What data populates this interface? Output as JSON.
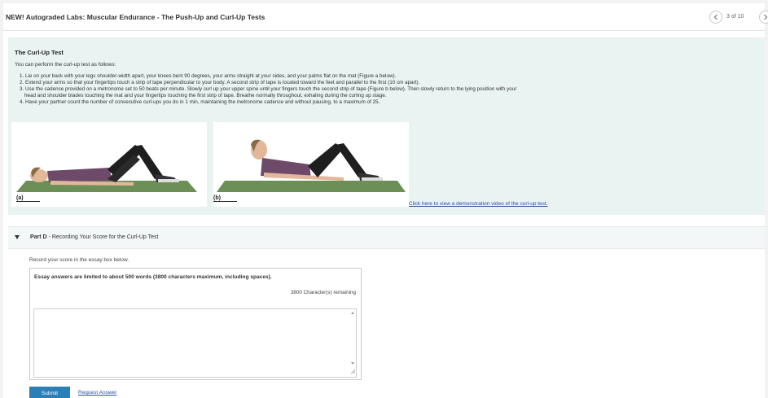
{
  "header": {
    "title": "NEW! Autograded Labs: Muscular Endurance - The Push-Up and Curl-Up Tests",
    "page_count": "3 of 10"
  },
  "panel": {
    "heading": "The Curl-Up Test",
    "intro": "You can perform the curl-up test as follows:",
    "steps": [
      "1. Lie on your back with your legs shoulder-width apart, your knees bent 90 degrees, your arms straight at your sides, and your palms flat on the mat (Figure a below).",
      "2. Extend your arms so that your fingertips touch a strip of tape perpendicular to your body. A second strip of tape is located toward the feet and parallel to the first (10 cm apart).",
      "3. Use the cadence provided on a metronome set to 50 beats per minute. Slowly curl up your upper spine until your fingers touch the second strip of tape (Figure b below). Then slowly return to the lying position with your",
      "head and shoulder blades touching the mat and your fingertips touching the first strip of tape. Breathe normally throughout, exhaling during the curling up stage.",
      "4. Have your partner count the number of consecutive curl-ups you do in 1 min, maintaining the metronome cadence and without pausing, to a maximum of 25."
    ],
    "figure_a_label": "(a)",
    "figure_b_label": "(b)",
    "video_link": "Click here to view a demonstration video of the curl-up test."
  },
  "part": {
    "name": "Part D",
    "title": "- Recording Your Score for the Curl-Up Test"
  },
  "answer": {
    "instruction": "Record your score in the essay box below.",
    "limit_note": "Essay answers are limited to about 500 words (3800 characters maximum, including spaces).",
    "remaining": "3800 Character(s) remaining",
    "value": ""
  },
  "actions": {
    "submit": "Submit",
    "request_answer": "Request Answer"
  },
  "colors": {
    "panel_bg": "#e8f3f2",
    "submit_bg": "#2b7fb8",
    "link": "#2a4fa3",
    "mat": "#6b8f55"
  },
  "icons": [
    "chevron-left-icon",
    "chevron-right-icon",
    "caret-down-icon",
    "resize-grip-icon"
  ]
}
